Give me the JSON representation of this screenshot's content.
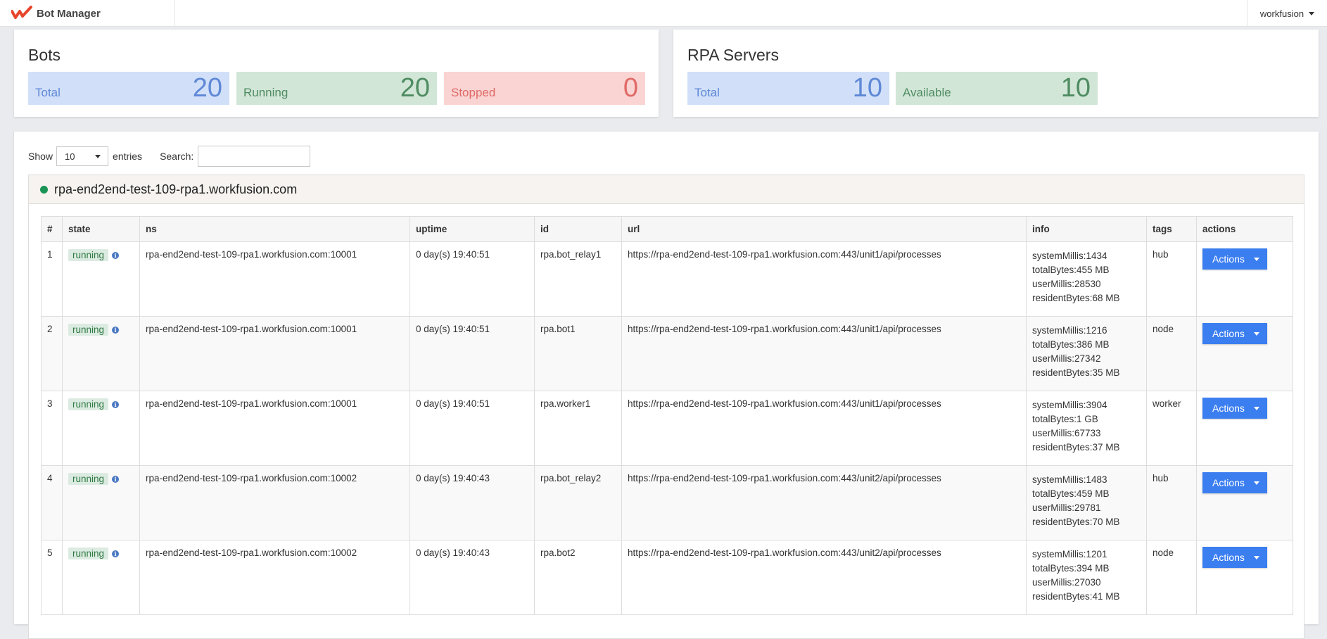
{
  "app": {
    "title": "Bot Manager",
    "user": "workfusion",
    "accent": "#3b7ef0",
    "logo_color": "#e8452c"
  },
  "bots_summary": {
    "title": "Bots",
    "total_label": "Total",
    "total_value": "20",
    "running_label": "Running",
    "running_value": "20",
    "stopped_label": "Stopped",
    "stopped_value": "0"
  },
  "rpa_summary": {
    "title": "RPA Servers",
    "total_label": "Total",
    "total_value": "10",
    "available_label": "Available",
    "available_value": "10"
  },
  "table_controls": {
    "show_label": "Show",
    "page_size": "10",
    "entries_label": "entries",
    "search_label": "Search:",
    "search_value": ""
  },
  "group": {
    "host": "rpa-end2end-test-109-rpa1.workfusion.com",
    "status_color": "#1a9455"
  },
  "columns": [
    "#",
    "state",
    "ns",
    "uptime",
    "id",
    "url",
    "info",
    "tags",
    "actions"
  ],
  "rows": [
    {
      "num": "1",
      "state": "running",
      "ns": "rpa-end2end-test-109-rpa1.workfusion.com:10001",
      "uptime": "0 day(s) 19:40:51",
      "id": "rpa.bot_relay1",
      "url": "https://rpa-end2end-test-109-rpa1.workfusion.com:443/unit1/api/processes",
      "info": [
        "systemMillis:1434",
        "totalBytes:455 MB",
        "userMillis:28530",
        "residentBytes:68 MB"
      ],
      "tags": "hub",
      "action": "Actions"
    },
    {
      "num": "2",
      "state": "running",
      "ns": "rpa-end2end-test-109-rpa1.workfusion.com:10001",
      "uptime": "0 day(s) 19:40:51",
      "id": "rpa.bot1",
      "url": "https://rpa-end2end-test-109-rpa1.workfusion.com:443/unit1/api/processes",
      "info": [
        "systemMillis:1216",
        "totalBytes:386 MB",
        "userMillis:27342",
        "residentBytes:35 MB"
      ],
      "tags": "node",
      "action": "Actions"
    },
    {
      "num": "3",
      "state": "running",
      "ns": "rpa-end2end-test-109-rpa1.workfusion.com:10001",
      "uptime": "0 day(s) 19:40:51",
      "id": "rpa.worker1",
      "url": "https://rpa-end2end-test-109-rpa1.workfusion.com:443/unit1/api/processes",
      "info": [
        "systemMillis:3904",
        "totalBytes:1 GB",
        "userMillis:67733",
        "residentBytes:37 MB"
      ],
      "tags": "worker",
      "action": "Actions"
    },
    {
      "num": "4",
      "state": "running",
      "ns": "rpa-end2end-test-109-rpa1.workfusion.com:10002",
      "uptime": "0 day(s) 19:40:43",
      "id": "rpa.bot_relay2",
      "url": "https://rpa-end2end-test-109-rpa1.workfusion.com:443/unit2/api/processes",
      "info": [
        "systemMillis:1483",
        "totalBytes:459 MB",
        "userMillis:29781",
        "residentBytes:70 MB"
      ],
      "tags": "hub",
      "action": "Actions"
    },
    {
      "num": "5",
      "state": "running",
      "ns": "rpa-end2end-test-109-rpa1.workfusion.com:10002",
      "uptime": "0 day(s) 19:40:43",
      "id": "rpa.bot2",
      "url": "https://rpa-end2end-test-109-rpa1.workfusion.com:443/unit2/api/processes",
      "info": [
        "systemMillis:1201",
        "totalBytes:394 MB",
        "userMillis:27030",
        "residentBytes:41 MB"
      ],
      "tags": "node",
      "action": "Actions"
    }
  ]
}
